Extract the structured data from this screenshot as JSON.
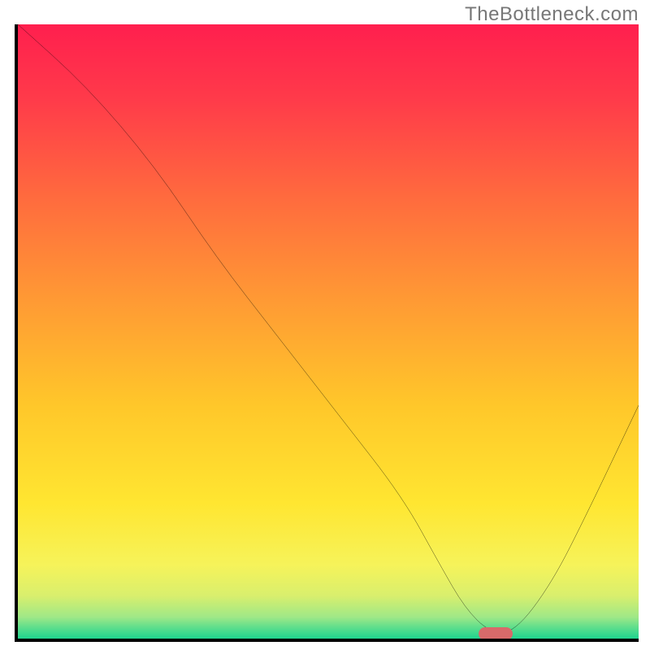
{
  "watermark": "TheBottleneck.com",
  "chart_data": {
    "type": "line",
    "title": "",
    "xlabel": "",
    "ylabel": "",
    "xlim": [
      0,
      100
    ],
    "ylim": [
      0,
      100
    ],
    "x": [
      0,
      11,
      22,
      32,
      42,
      52,
      62,
      68,
      72,
      76,
      80,
      86,
      92,
      100
    ],
    "values": [
      100,
      90,
      77,
      62,
      49,
      36,
      23,
      12,
      5,
      1,
      1,
      9,
      21,
      38
    ],
    "min_marker": {
      "x": 77,
      "y": 0.8,
      "width_pct": 5.5,
      "height_pct": 2.0,
      "color": "#d86a6a"
    },
    "gradient_stops": [
      {
        "offset": 0.0,
        "color": "#ff1f4e"
      },
      {
        "offset": 0.12,
        "color": "#ff3a4a"
      },
      {
        "offset": 0.28,
        "color": "#ff6a3e"
      },
      {
        "offset": 0.45,
        "color": "#ff9a34"
      },
      {
        "offset": 0.62,
        "color": "#ffc72a"
      },
      {
        "offset": 0.78,
        "color": "#ffe631"
      },
      {
        "offset": 0.88,
        "color": "#f6f35a"
      },
      {
        "offset": 0.93,
        "color": "#d9ef6d"
      },
      {
        "offset": 0.965,
        "color": "#9fe887"
      },
      {
        "offset": 0.985,
        "color": "#52dc8d"
      },
      {
        "offset": 1.0,
        "color": "#1fd38f"
      }
    ]
  }
}
